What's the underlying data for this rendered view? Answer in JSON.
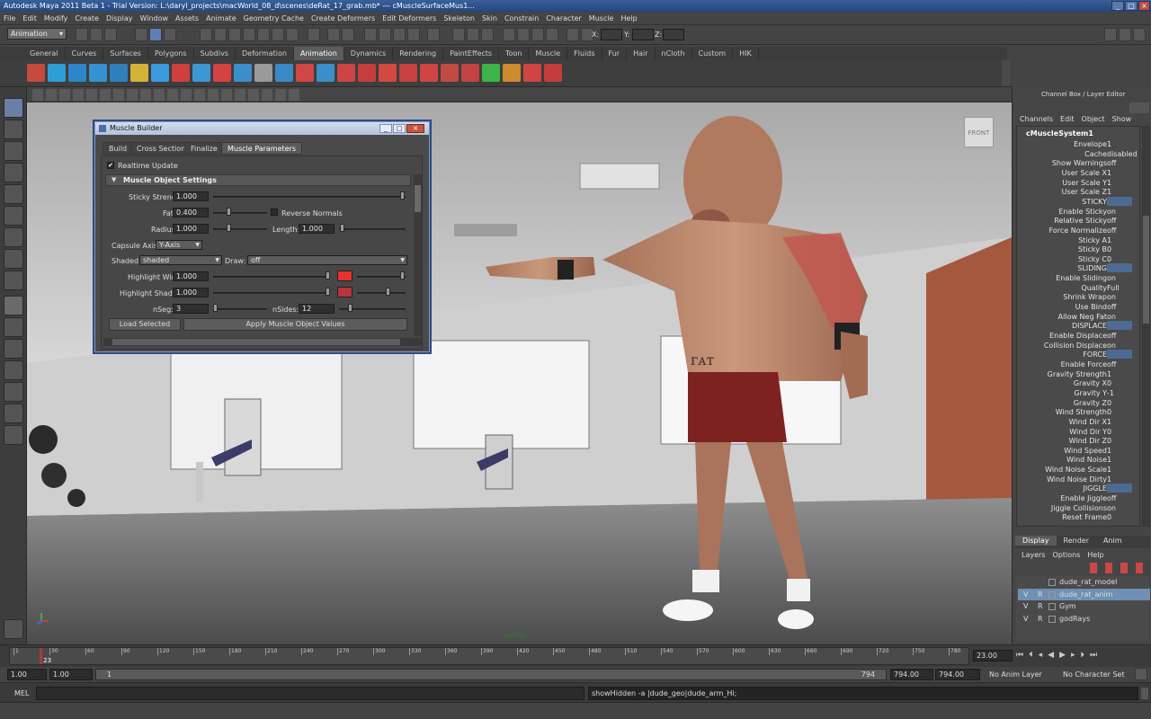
{
  "window": {
    "title": "Autodesk Maya 2011 Beta 1 - Trial Version: L:\\daryl_projects\\macWorld_08_d\\scenes\\deRat_17_grab.mb*  ---  cMuscleSurfaceMus1..."
  },
  "menubar": [
    "File",
    "Edit",
    "Modify",
    "Create",
    "Display",
    "Window",
    "Assets",
    "Animate",
    "Geometry Cache",
    "Create Deformers",
    "Edit Deformers",
    "Skeleton",
    "Skin",
    "Constrain",
    "Character",
    "Muscle",
    "Help"
  ],
  "statusline": {
    "menuset": "Animation",
    "x_label": "X:",
    "y_label": "Y:",
    "z_label": "Z:"
  },
  "shelf_tabs": [
    "General",
    "Curves",
    "Surfaces",
    "Polygons",
    "Subdivs",
    "Deformation",
    "Animation",
    "Dynamics",
    "Rendering",
    "PaintEffects",
    "Toon",
    "Muscle",
    "Fluids",
    "Fur",
    "Hair",
    "nCloth",
    "Custom",
    "HIK"
  ],
  "shelf_active": "Animation",
  "viewport": {
    "camera_label": "persp",
    "view_cube": "FRONT"
  },
  "dialog": {
    "title": "Muscle Builder",
    "tabs": [
      "Build",
      "Cross Section",
      "Finalize",
      "Muscle Parameters"
    ],
    "realtime_update": "Realtime Update",
    "section": "Muscle Object Settings",
    "sticky_strength": {
      "label": "Sticky Strength:",
      "value": "1.000"
    },
    "fat": {
      "label": "Fat:",
      "value": "0.400"
    },
    "reverse_normals": "Reverse Normals",
    "radius": {
      "label": "Radius:",
      "value": "1.000"
    },
    "length": {
      "label": "Length:",
      "value": "1.000"
    },
    "capsule_axis": {
      "label": "Capsule Axis:",
      "value": "Y-Axis"
    },
    "shaded": {
      "label": "Shaded:",
      "value": "shaded"
    },
    "draw": {
      "label": "Draw:",
      "value": "off"
    },
    "highlight_wire": {
      "label": "Highlight Wire:",
      "value": "1.000",
      "color": "#e8312e"
    },
    "highlight_shaded": {
      "label": "Highlight Shaded:",
      "value": "1.000",
      "color": "#b7343a"
    },
    "nseg": {
      "label": "nSeg:",
      "value": "3"
    },
    "nsides": {
      "label": "nSides:",
      "value": "12"
    },
    "load_selected": "Load Selected",
    "apply": "Apply Muscle Object Values"
  },
  "channel_box": {
    "header": "Channel Box / Layer Editor",
    "menus": [
      "Channels",
      "Edit",
      "Object",
      "Show"
    ],
    "node": "cMuscleSystem1",
    "rows": [
      {
        "name": "Envelope",
        "value": "1"
      },
      {
        "name": "Cache",
        "value": "disabled"
      },
      {
        "name": "Show Warnings",
        "value": "off"
      },
      {
        "name": "User Scale X",
        "value": "1"
      },
      {
        "name": "User Scale Y",
        "value": "1"
      },
      {
        "name": "User Scale Z",
        "value": "1"
      },
      {
        "name": "STICKY",
        "value": "",
        "section": true
      },
      {
        "name": "Enable Sticky",
        "value": "on"
      },
      {
        "name": "Relative Sticky",
        "value": "off"
      },
      {
        "name": "Force Normalize",
        "value": "off"
      },
      {
        "name": "Sticky A",
        "value": "1"
      },
      {
        "name": "Sticky B",
        "value": "0"
      },
      {
        "name": "Sticky C",
        "value": "0"
      },
      {
        "name": "SLIDING",
        "value": "",
        "section": true
      },
      {
        "name": "Enable Sliding",
        "value": "on"
      },
      {
        "name": "Quality",
        "value": "Full"
      },
      {
        "name": "Shrink Wrap",
        "value": "on"
      },
      {
        "name": "Use Bind",
        "value": "off"
      },
      {
        "name": "Allow Neg Fat",
        "value": "on"
      },
      {
        "name": "DISPLACE",
        "value": "",
        "section": true
      },
      {
        "name": "Enable Displace",
        "value": "off"
      },
      {
        "name": "Collision Displace",
        "value": "on"
      },
      {
        "name": "FORCE",
        "value": "",
        "section": true
      },
      {
        "name": "Enable Force",
        "value": "off"
      },
      {
        "name": "Gravity Strength",
        "value": "1"
      },
      {
        "name": "Gravity X",
        "value": "0"
      },
      {
        "name": "Gravity Y",
        "value": "-1"
      },
      {
        "name": "Gravity Z",
        "value": "0"
      },
      {
        "name": "Wind Strength",
        "value": "0"
      },
      {
        "name": "Wind Dir X",
        "value": "1"
      },
      {
        "name": "Wind Dir Y",
        "value": "0"
      },
      {
        "name": "Wind Dir Z",
        "value": "0"
      },
      {
        "name": "Wind Speed",
        "value": "1"
      },
      {
        "name": "Wind Noise",
        "value": "1"
      },
      {
        "name": "Wind Noise Scale",
        "value": "1"
      },
      {
        "name": "Wind Noise Dirty",
        "value": "1"
      },
      {
        "name": "JIGGLE",
        "value": "",
        "section": true
      },
      {
        "name": "Enable Jiggle",
        "value": "off"
      },
      {
        "name": "Jiggle Collisions",
        "value": "on"
      },
      {
        "name": "Reset Frame",
        "value": "0"
      }
    ]
  },
  "layer_editor": {
    "tabs": [
      "Display",
      "Render",
      "Anim"
    ],
    "menus": [
      "Layers",
      "Options",
      "Help"
    ],
    "layers": [
      {
        "v": "",
        "r": "",
        "name": "dude_rat_model",
        "selected": false
      },
      {
        "v": "V",
        "r": "R",
        "name": "dude_rat_anim",
        "selected": true
      },
      {
        "v": "V",
        "r": "R",
        "name": "Gym",
        "selected": false
      },
      {
        "v": "V",
        "r": "R",
        "name": "godRays",
        "selected": false
      }
    ]
  },
  "timeline": {
    "ticks": [
      "1",
      "30",
      "60",
      "90",
      "120",
      "150",
      "180",
      "210",
      "240",
      "270",
      "300",
      "330",
      "360",
      "390",
      "420",
      "450",
      "480",
      "510",
      "540",
      "570",
      "600",
      "630",
      "660",
      "690",
      "720",
      "750",
      "780"
    ],
    "current": "23",
    "current_field": "23.00",
    "playhead_fraction": 0.028
  },
  "range": {
    "start": "1.00",
    "range_start": "1.00",
    "slider_start": "1",
    "slider_end": "794",
    "range_end": "794.00",
    "end": "794.00",
    "anim_layer": "No Anim Layer",
    "character_set": "No Character Set"
  },
  "cmdline": {
    "label": "MEL",
    "result": "showHidden -a |dude_geo|dude_arm_Hi;"
  }
}
